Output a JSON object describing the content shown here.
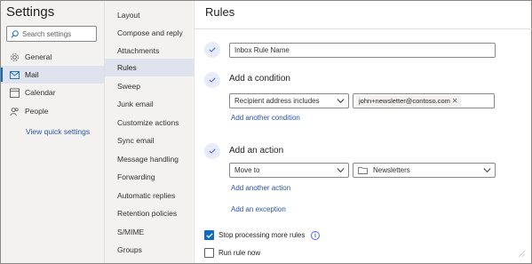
{
  "left_panel": {
    "title": "Settings",
    "search_placeholder": "Search settings",
    "nav": [
      {
        "label": "General",
        "icon": "gear-icon"
      },
      {
        "label": "Mail",
        "icon": "mail-icon",
        "selected": true
      },
      {
        "label": "Calendar",
        "icon": "calendar-icon"
      },
      {
        "label": "People",
        "icon": "people-icon"
      }
    ],
    "quick_settings_link": "View quick settings"
  },
  "middle_panel": {
    "items": [
      {
        "label": "Layout"
      },
      {
        "label": "Compose and reply"
      },
      {
        "label": "Attachments"
      },
      {
        "label": "Rules",
        "selected": true
      },
      {
        "label": "Sweep"
      },
      {
        "label": "Junk email"
      },
      {
        "label": "Customize actions"
      },
      {
        "label": "Sync email"
      },
      {
        "label": "Message handling"
      },
      {
        "label": "Forwarding"
      },
      {
        "label": "Automatic replies"
      },
      {
        "label": "Retention policies"
      },
      {
        "label": "S/MIME"
      },
      {
        "label": "Groups"
      }
    ]
  },
  "main": {
    "title": "Rules",
    "rule_name_value": "Inbox Rule Name",
    "condition": {
      "heading": "Add a condition",
      "selected": "Recipient address includes",
      "value_pill": "john+newsletter@contoso.com",
      "add_link": "Add another condition"
    },
    "action": {
      "heading": "Add an action",
      "selected": "Move to",
      "folder": "Newsletters",
      "add_link": "Add another action"
    },
    "exception_link": "Add an exception",
    "stop_processing": {
      "label": "Stop processing more rules",
      "checked": true
    },
    "run_now": {
      "label": "Run rule now",
      "checked": false
    }
  },
  "colors": {
    "accent": "#0f6cbd",
    "link": "#2a55a5",
    "nav_bg": "#f3f2f1",
    "selected_bg": "#dfe3ee"
  }
}
